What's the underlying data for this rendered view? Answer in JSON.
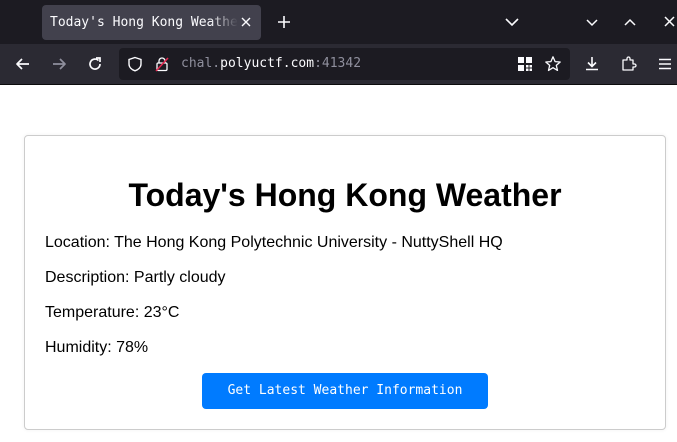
{
  "browser": {
    "tab_title": "Today's Hong Kong Weather",
    "url_prefix": "chal.",
    "url_domain": "polyuctf.com",
    "url_port": ":41342",
    "icons": {
      "tab_close": "close-icon",
      "new_tab": "plus-icon",
      "tab_list": "chevron-down-icon",
      "back": "arrow-left-icon",
      "forward": "arrow-right-icon",
      "reload": "reload-icon",
      "tracking_protection": "shield-icon",
      "connection": "lock-icon",
      "qr_code": "qr-code-icon",
      "bookmark": "star-icon",
      "downloads": "download-icon",
      "extensions": "puzzle-icon",
      "menu": "hamburger-icon"
    }
  },
  "page": {
    "title": "Today's Hong Kong Weather",
    "location": "Location: The Hong Kong Polytechnic University - NuttyShell HQ",
    "description": "Description: Partly cloudy",
    "temperature": "Temperature: 23°C",
    "humidity": "Humidity: 78%",
    "button_label": "Get Latest Weather Information"
  },
  "colors": {
    "button_bg": "#007bff",
    "button_text": "#ffffff",
    "tabbar_bg": "#1c1b22",
    "navbar_bg": "#2b2a33",
    "active_tab_bg": "#42414d"
  }
}
